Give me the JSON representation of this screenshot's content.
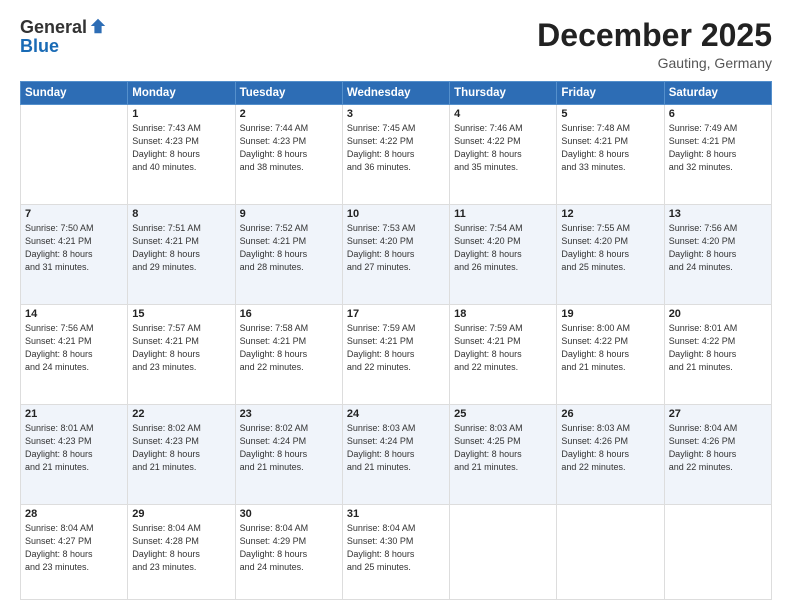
{
  "header": {
    "logo_general": "General",
    "logo_blue": "Blue",
    "month": "December 2025",
    "location": "Gauting, Germany"
  },
  "days_of_week": [
    "Sunday",
    "Monday",
    "Tuesday",
    "Wednesday",
    "Thursday",
    "Friday",
    "Saturday"
  ],
  "weeks": [
    [
      {
        "day": "",
        "text": ""
      },
      {
        "day": "1",
        "text": "Sunrise: 7:43 AM\nSunset: 4:23 PM\nDaylight: 8 hours\nand 40 minutes."
      },
      {
        "day": "2",
        "text": "Sunrise: 7:44 AM\nSunset: 4:23 PM\nDaylight: 8 hours\nand 38 minutes."
      },
      {
        "day": "3",
        "text": "Sunrise: 7:45 AM\nSunset: 4:22 PM\nDaylight: 8 hours\nand 36 minutes."
      },
      {
        "day": "4",
        "text": "Sunrise: 7:46 AM\nSunset: 4:22 PM\nDaylight: 8 hours\nand 35 minutes."
      },
      {
        "day": "5",
        "text": "Sunrise: 7:48 AM\nSunset: 4:21 PM\nDaylight: 8 hours\nand 33 minutes."
      },
      {
        "day": "6",
        "text": "Sunrise: 7:49 AM\nSunset: 4:21 PM\nDaylight: 8 hours\nand 32 minutes."
      }
    ],
    [
      {
        "day": "7",
        "text": "Sunrise: 7:50 AM\nSunset: 4:21 PM\nDaylight: 8 hours\nand 31 minutes."
      },
      {
        "day": "8",
        "text": "Sunrise: 7:51 AM\nSunset: 4:21 PM\nDaylight: 8 hours\nand 29 minutes."
      },
      {
        "day": "9",
        "text": "Sunrise: 7:52 AM\nSunset: 4:21 PM\nDaylight: 8 hours\nand 28 minutes."
      },
      {
        "day": "10",
        "text": "Sunrise: 7:53 AM\nSunset: 4:20 PM\nDaylight: 8 hours\nand 27 minutes."
      },
      {
        "day": "11",
        "text": "Sunrise: 7:54 AM\nSunset: 4:20 PM\nDaylight: 8 hours\nand 26 minutes."
      },
      {
        "day": "12",
        "text": "Sunrise: 7:55 AM\nSunset: 4:20 PM\nDaylight: 8 hours\nand 25 minutes."
      },
      {
        "day": "13",
        "text": "Sunrise: 7:56 AM\nSunset: 4:20 PM\nDaylight: 8 hours\nand 24 minutes."
      }
    ],
    [
      {
        "day": "14",
        "text": "Sunrise: 7:56 AM\nSunset: 4:21 PM\nDaylight: 8 hours\nand 24 minutes."
      },
      {
        "day": "15",
        "text": "Sunrise: 7:57 AM\nSunset: 4:21 PM\nDaylight: 8 hours\nand 23 minutes."
      },
      {
        "day": "16",
        "text": "Sunrise: 7:58 AM\nSunset: 4:21 PM\nDaylight: 8 hours\nand 22 minutes."
      },
      {
        "day": "17",
        "text": "Sunrise: 7:59 AM\nSunset: 4:21 PM\nDaylight: 8 hours\nand 22 minutes."
      },
      {
        "day": "18",
        "text": "Sunrise: 7:59 AM\nSunset: 4:21 PM\nDaylight: 8 hours\nand 22 minutes."
      },
      {
        "day": "19",
        "text": "Sunrise: 8:00 AM\nSunset: 4:22 PM\nDaylight: 8 hours\nand 21 minutes."
      },
      {
        "day": "20",
        "text": "Sunrise: 8:01 AM\nSunset: 4:22 PM\nDaylight: 8 hours\nand 21 minutes."
      }
    ],
    [
      {
        "day": "21",
        "text": "Sunrise: 8:01 AM\nSunset: 4:23 PM\nDaylight: 8 hours\nand 21 minutes."
      },
      {
        "day": "22",
        "text": "Sunrise: 8:02 AM\nSunset: 4:23 PM\nDaylight: 8 hours\nand 21 minutes."
      },
      {
        "day": "23",
        "text": "Sunrise: 8:02 AM\nSunset: 4:24 PM\nDaylight: 8 hours\nand 21 minutes."
      },
      {
        "day": "24",
        "text": "Sunrise: 8:03 AM\nSunset: 4:24 PM\nDaylight: 8 hours\nand 21 minutes."
      },
      {
        "day": "25",
        "text": "Sunrise: 8:03 AM\nSunset: 4:25 PM\nDaylight: 8 hours\nand 21 minutes."
      },
      {
        "day": "26",
        "text": "Sunrise: 8:03 AM\nSunset: 4:26 PM\nDaylight: 8 hours\nand 22 minutes."
      },
      {
        "day": "27",
        "text": "Sunrise: 8:04 AM\nSunset: 4:26 PM\nDaylight: 8 hours\nand 22 minutes."
      }
    ],
    [
      {
        "day": "28",
        "text": "Sunrise: 8:04 AM\nSunset: 4:27 PM\nDaylight: 8 hours\nand 23 minutes."
      },
      {
        "day": "29",
        "text": "Sunrise: 8:04 AM\nSunset: 4:28 PM\nDaylight: 8 hours\nand 23 minutes."
      },
      {
        "day": "30",
        "text": "Sunrise: 8:04 AM\nSunset: 4:29 PM\nDaylight: 8 hours\nand 24 minutes."
      },
      {
        "day": "31",
        "text": "Sunrise: 8:04 AM\nSunset: 4:30 PM\nDaylight: 8 hours\nand 25 minutes."
      },
      {
        "day": "",
        "text": ""
      },
      {
        "day": "",
        "text": ""
      },
      {
        "day": "",
        "text": ""
      }
    ]
  ]
}
